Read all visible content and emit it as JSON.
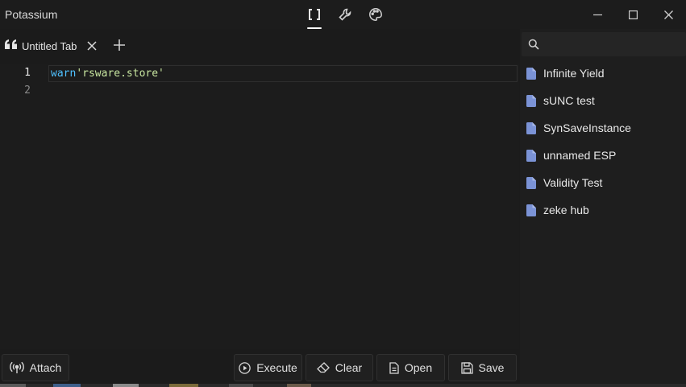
{
  "app": {
    "title": "Potassium"
  },
  "toolbar": {
    "editor_icon_glyph": "[ ]",
    "icons": [
      "brackets-icon",
      "wrench-icon",
      "palette-icon"
    ]
  },
  "tabs": [
    {
      "label": "Untitled Tab",
      "icon": "quote-icon"
    }
  ],
  "editor": {
    "line_numbers": [
      "1",
      "2"
    ],
    "code": {
      "keyword": "warn",
      "string": "'rsware.store'"
    }
  },
  "sidebar": {
    "search": {
      "placeholder": "",
      "value": ""
    },
    "scripts": [
      {
        "label": "Infinite Yield"
      },
      {
        "label": "sUNC test"
      },
      {
        "label": "SynSaveInstance"
      },
      {
        "label": "unnamed ESP"
      },
      {
        "label": "Validity Test"
      },
      {
        "label": "zeke hub"
      }
    ]
  },
  "actions": {
    "attach": "Attach",
    "execute": "Execute",
    "clear": "Clear",
    "open": "Open",
    "save": "Save"
  },
  "colors": {
    "background": "#1b1b1b",
    "keyword": "#4fc1ff",
    "string": "#c8e6a0",
    "file_icon": "#7b93d6"
  }
}
